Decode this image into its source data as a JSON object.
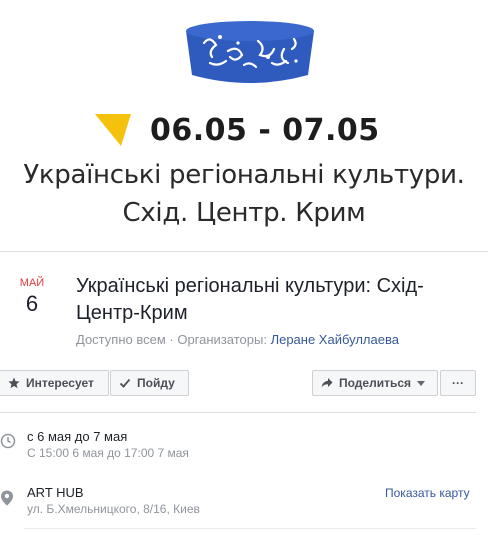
{
  "cover": {
    "dates": "06.05 - 07.05",
    "title_line1": "Українські регіональні культури.",
    "title_line2": "Схід. Центр. Крим",
    "hat_color": "#2f5bbf",
    "corner_color": "#f4c20d"
  },
  "event": {
    "month": "МАЙ",
    "day": "6",
    "title": "Українські регіональні культури: Схід-Центр-Крим",
    "privacy": "Доступно всем",
    "separator": " · ",
    "organizers_label": "Организаторы: ",
    "organizer": "Леране Хайбуллаева"
  },
  "actions": {
    "interested": "Интересует",
    "going": "Пойду",
    "share": "Поделиться",
    "more": "···"
  },
  "details": {
    "time_main": "с 6 мая до 7 мая",
    "time_sub": "С 15:00 6 мая до 17:00 7 мая",
    "place_name": "ART HUB",
    "place_address": "ул. Б.Хмельницкого, 8/16, Киев",
    "map_link": "Показать карту"
  }
}
